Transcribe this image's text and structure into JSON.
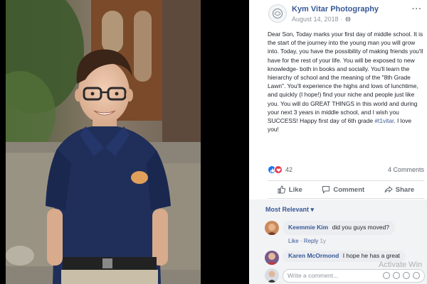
{
  "post": {
    "page_name": "Kym Vitar Photography",
    "date": "August 14, 2018",
    "separator": "·",
    "body_text": "Dear Son, Today marks your first day of middle school. It is the start of the journey into the young man you will grow into. Today, you have the possibility of making friends you'll have for the rest of your life. You will be exposed to new knowledge- both in books and socially. You'll learn the hierarchy of school and the meaning of the \"8th Grade Lawn\". You'll experience the highs and lows of lunchtime, and quickly (I hope!) find your niche and people just like you. You will do GREAT THINGS in this world and during your next 3 years in middle school, and I wish you SUCCESS! Happy first day of 6th grade ",
    "hashtag": "#t1vitar",
    "body_end": ". I love you!",
    "reaction_count": "42",
    "comment_count": "4 Comments"
  },
  "actions": {
    "like": "Like",
    "comment": "Comment",
    "share": "Share"
  },
  "comments": {
    "sort_label": "Most Relevant",
    "items": [
      {
        "author": "Keemmie Kim",
        "text": "did you guys moved?",
        "like": "Like",
        "dot": "·",
        "reply": "Reply",
        "time": "1y"
      },
      {
        "author": "Karen McOrmond",
        "text": "I hope he has a great"
      }
    ],
    "composer_placeholder": "Write a comment..."
  },
  "watermark": "Activate Win",
  "icons": {
    "page_avatar": "camera-logo-icon",
    "globe": "globe-icon",
    "more": "more-options-icon",
    "like": "thumbs-up-icon",
    "comment": "speech-bubble-icon",
    "share": "share-arrow-icon"
  },
  "colors": {
    "link_blue": "#385898",
    "like_blue": "#1877f2",
    "love_red": "#e8384f",
    "shirt_navy": "#1f2f5a"
  }
}
